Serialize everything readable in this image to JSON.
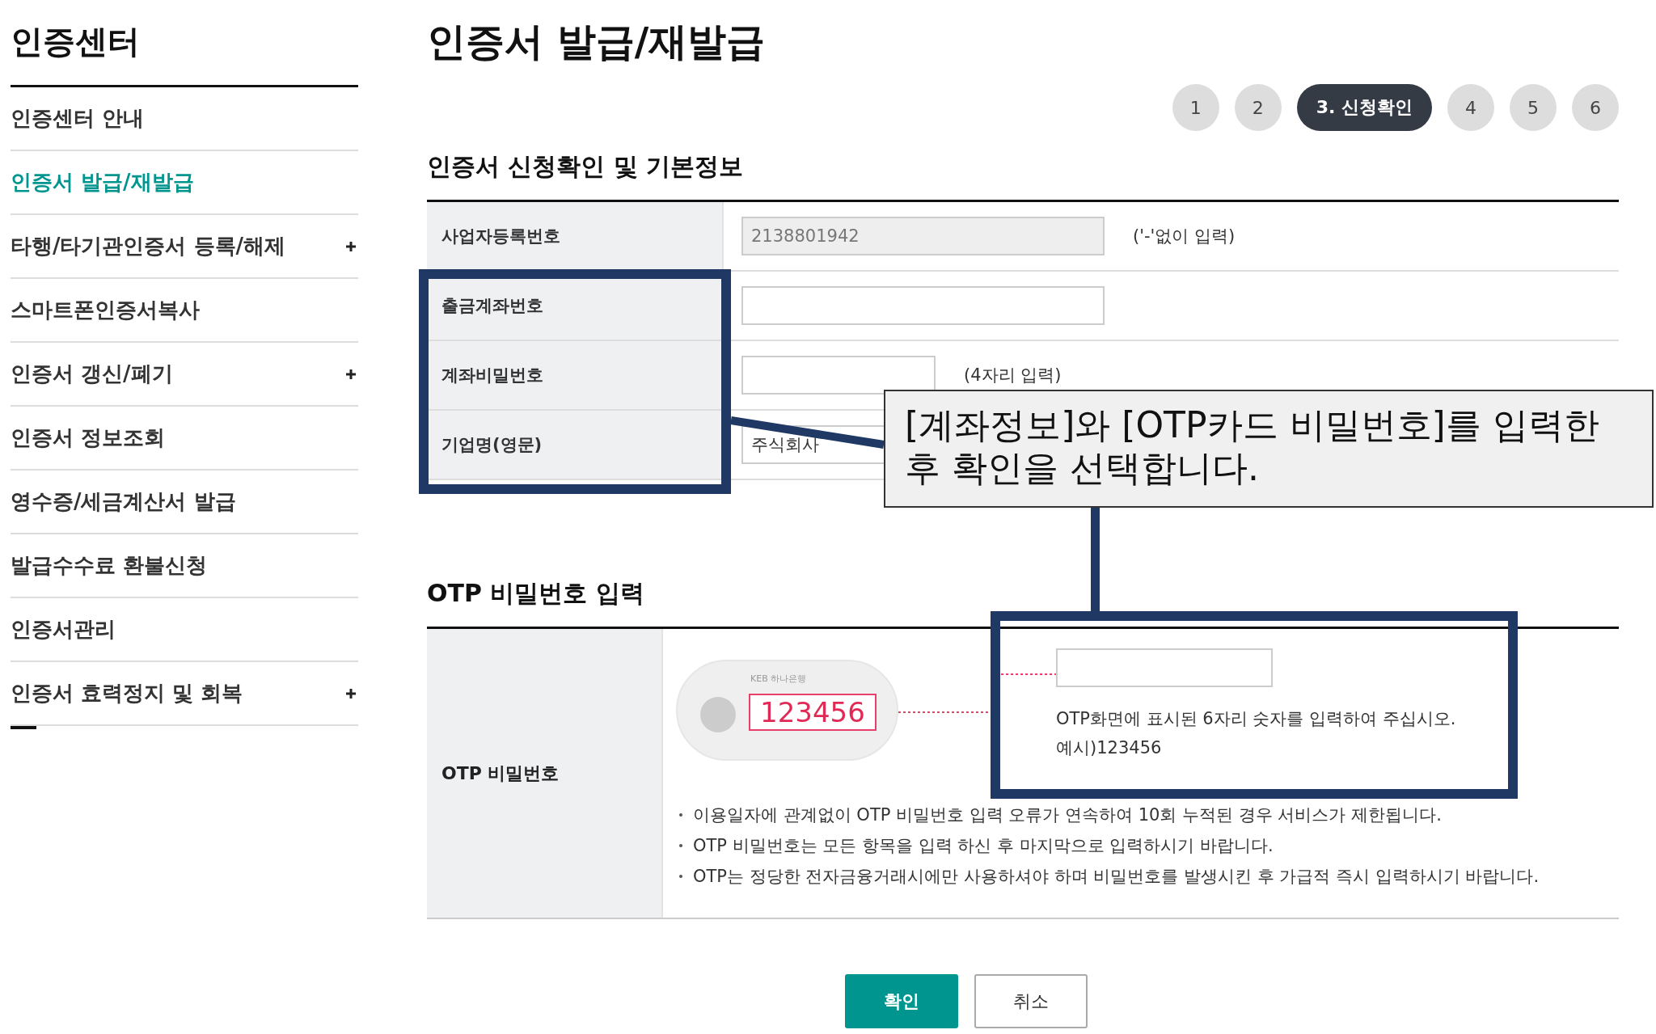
{
  "sidebar": {
    "title": "인증센터",
    "items": [
      {
        "label": "인증센터 안내",
        "selected": false,
        "expandable": false
      },
      {
        "label": "인증서 발급/재발급",
        "selected": true,
        "expandable": false
      },
      {
        "label": "타행/타기관인증서 등록/해제",
        "selected": false,
        "expandable": true
      },
      {
        "label": "스마트폰인증서복사",
        "selected": false,
        "expandable": false
      },
      {
        "label": "인증서 갱신/폐기",
        "selected": false,
        "expandable": true
      },
      {
        "label": "인증서 정보조회",
        "selected": false,
        "expandable": false
      },
      {
        "label": "영수증/세금계산서 발급",
        "selected": false,
        "expandable": false
      },
      {
        "label": "발급수수료 환불신청",
        "selected": false,
        "expandable": false
      },
      {
        "label": "인증서관리",
        "selected": false,
        "expandable": false
      },
      {
        "label": "인증서 효력정지 및 회복",
        "selected": false,
        "expandable": true
      }
    ]
  },
  "page_title": "인증서 발급/재발급",
  "steps": [
    {
      "label": "1",
      "selected": false
    },
    {
      "label": "2",
      "selected": false
    },
    {
      "label": "3. 신청확인",
      "selected": true
    },
    {
      "label": "4",
      "selected": false
    },
    {
      "label": "5",
      "selected": false
    },
    {
      "label": "6",
      "selected": false
    }
  ],
  "basic_info": {
    "title": "인증서 신청확인 및 기본정보",
    "rows": [
      {
        "label": "사업자등록번호",
        "kind": "wide",
        "value": "2138801942",
        "disabled": true,
        "note": "('-'없이 입력)"
      },
      {
        "label": "출금계좌번호",
        "kind": "wide",
        "disabled": false
      },
      {
        "label": "계좌비밀번호",
        "kind": "short",
        "disabled": false,
        "note": "(4자리 입력)"
      },
      {
        "label": "기업명(영문)",
        "kind": "wide",
        "value": "주식회사",
        "disabled": false
      }
    ]
  },
  "otp": {
    "title": "OTP 비밀번호 입력",
    "label": "OTP 비밀번호",
    "token_brand": "KEB 하나은행",
    "token_code": "123456",
    "hint": "OTP화면에 표시된 6자리 숫자를 입력하여 주십시오.",
    "example": "예시)123456",
    "notes": [
      "이용일자에 관계없이 OTP 비밀번호 입력 오류가 연속하여 10회 누적된 경우 서비스가 제한됩니다.",
      "OTP 비밀번호는 모든 항목을 입력 하신 후 마지막으로 입력하시기 바랍니다.",
      "OTP는 정당한 전자금융거래시에만 사용하셔야 하며 비밀번호를 발생시킨 후 가급적 즉시 입력하시기 바랍니다."
    ]
  },
  "buttons": [
    {
      "label": "확인",
      "kind": "primary"
    },
    {
      "label": "취소",
      "kind": "secondary"
    }
  ],
  "callout": {
    "text": "[계좌정보]와 [OTP카드 비밀번호]를 입력한 후 확인을 선택합니다."
  }
}
